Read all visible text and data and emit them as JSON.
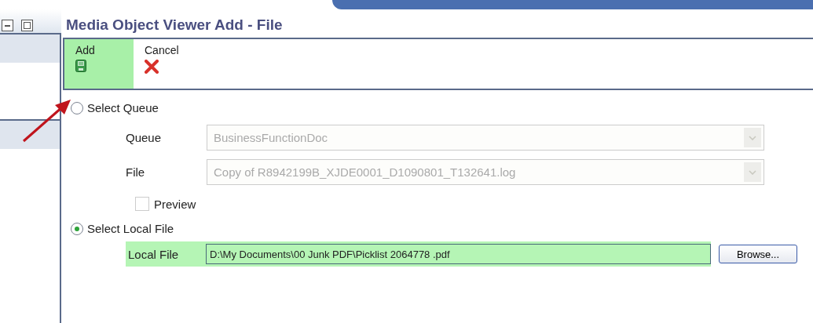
{
  "window": {
    "title": "Media Object Viewer Add - File"
  },
  "toolbar": [
    {
      "kind": "save",
      "label": "Add",
      "highlighted": true
    },
    {
      "kind": "cancel",
      "label": "Cancel",
      "highlighted": false
    }
  ],
  "source_options": [
    {
      "label": "Select Queue",
      "selected": false
    },
    {
      "label": "Select Local File",
      "selected": true
    }
  ],
  "queue": {
    "label": "Queue",
    "value": "BusinessFunctionDoc",
    "disabled": true
  },
  "file": {
    "label": "File",
    "value": "Copy of R8942199B_XJDE0001_D1090801_T132641.log",
    "disabled": true
  },
  "preview": {
    "label": "Preview",
    "checked": false,
    "disabled": true
  },
  "local_file": {
    "label": "Local File",
    "value": "D:\\My Documents\\00 Junk PDF\\Picklist 2064778 .pdf",
    "highlighted": true
  },
  "browse_button": "Browse..."
}
